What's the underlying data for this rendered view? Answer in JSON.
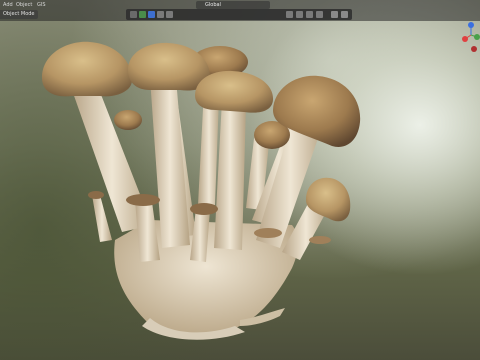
{
  "header": {
    "menus": [
      "Add",
      "Object",
      "GIS"
    ],
    "editor_type": "Object Mode",
    "transform_orientation": "Global"
  },
  "colors": {
    "axis_x": "#e04040",
    "axis_y": "#4aa04a",
    "axis_z": "#3a6fe0"
  },
  "icons": [
    "hand-icon",
    "proportional-editing-icon",
    "viewport-shading-icon",
    "gizmo-icon",
    "filter-icon"
  ],
  "viewport": {
    "subject": "mushroom cluster"
  }
}
